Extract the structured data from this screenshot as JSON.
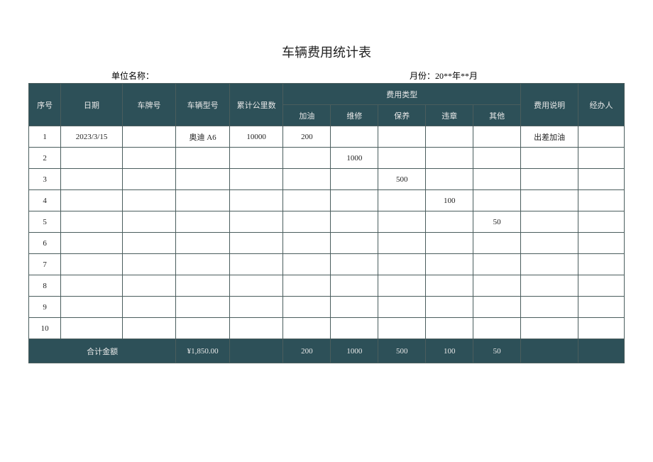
{
  "title": "车辆费用统计表",
  "meta": {
    "unit_label": "单位名称：",
    "month_label": "月份：20**年**月"
  },
  "headers": {
    "seq": "序号",
    "date": "日期",
    "plate": "车牌号",
    "model": "车辆型号",
    "km": "累计公里数",
    "fee_type": "费用类型",
    "fuel": "加油",
    "repair": "维修",
    "maint": "保养",
    "violation": "违章",
    "other": "其他",
    "desc": "费用说明",
    "agent": "经办人"
  },
  "rows": [
    {
      "seq": "1",
      "date": "2023/3/15",
      "plate": "",
      "model": "奥迪 A6",
      "km": "10000",
      "fuel": "200",
      "repair": "",
      "maint": "",
      "violation": "",
      "other": "",
      "desc": "出差加油",
      "agent": ""
    },
    {
      "seq": "2",
      "date": "",
      "plate": "",
      "model": "",
      "km": "",
      "fuel": "",
      "repair": "1000",
      "maint": "",
      "violation": "",
      "other": "",
      "desc": "",
      "agent": ""
    },
    {
      "seq": "3",
      "date": "",
      "plate": "",
      "model": "",
      "km": "",
      "fuel": "",
      "repair": "",
      "maint": "500",
      "violation": "",
      "other": "",
      "desc": "",
      "agent": ""
    },
    {
      "seq": "4",
      "date": "",
      "plate": "",
      "model": "",
      "km": "",
      "fuel": "",
      "repair": "",
      "maint": "",
      "violation": "100",
      "other": "",
      "desc": "",
      "agent": ""
    },
    {
      "seq": "5",
      "date": "",
      "plate": "",
      "model": "",
      "km": "",
      "fuel": "",
      "repair": "",
      "maint": "",
      "violation": "",
      "other": "50",
      "desc": "",
      "agent": ""
    },
    {
      "seq": "6",
      "date": "",
      "plate": "",
      "model": "",
      "km": "",
      "fuel": "",
      "repair": "",
      "maint": "",
      "violation": "",
      "other": "",
      "desc": "",
      "agent": ""
    },
    {
      "seq": "7",
      "date": "",
      "plate": "",
      "model": "",
      "km": "",
      "fuel": "",
      "repair": "",
      "maint": "",
      "violation": "",
      "other": "",
      "desc": "",
      "agent": ""
    },
    {
      "seq": "8",
      "date": "",
      "plate": "",
      "model": "",
      "km": "",
      "fuel": "",
      "repair": "",
      "maint": "",
      "violation": "",
      "other": "",
      "desc": "",
      "agent": ""
    },
    {
      "seq": "9",
      "date": "",
      "plate": "",
      "model": "",
      "km": "",
      "fuel": "",
      "repair": "",
      "maint": "",
      "violation": "",
      "other": "",
      "desc": "",
      "agent": ""
    },
    {
      "seq": "10",
      "date": "",
      "plate": "",
      "model": "",
      "km": "",
      "fuel": "",
      "repair": "",
      "maint": "",
      "violation": "",
      "other": "",
      "desc": "",
      "agent": ""
    }
  ],
  "totals": {
    "label": "合计金额",
    "amount": "¥1,850.00",
    "fuel": "200",
    "repair": "1000",
    "maint": "500",
    "violation": "100",
    "other": "50"
  },
  "chart_data": {
    "type": "table",
    "title": "车辆费用统计表",
    "columns": [
      "序号",
      "日期",
      "车牌号",
      "车辆型号",
      "累计公里数",
      "加油",
      "维修",
      "保养",
      "违章",
      "其他",
      "费用说明",
      "经办人"
    ],
    "rows": [
      [
        "1",
        "2023/3/15",
        "",
        "奥迪 A6",
        "10000",
        "200",
        "",
        "",
        "",
        "",
        "出差加油",
        ""
      ],
      [
        "2",
        "",
        "",
        "",
        "",
        "",
        "1000",
        "",
        "",
        "",
        "",
        ""
      ],
      [
        "3",
        "",
        "",
        "",
        "",
        "",
        "",
        "500",
        "",
        "",
        "",
        ""
      ],
      [
        "4",
        "",
        "",
        "",
        "",
        "",
        "",
        "",
        "100",
        "",
        "",
        ""
      ],
      [
        "5",
        "",
        "",
        "",
        "",
        "",
        "",
        "",
        "",
        "50",
        "",
        ""
      ],
      [
        "6",
        "",
        "",
        "",
        "",
        "",
        "",
        "",
        "",
        "",
        "",
        ""
      ],
      [
        "7",
        "",
        "",
        "",
        "",
        "",
        "",
        "",
        "",
        "",
        "",
        ""
      ],
      [
        "8",
        "",
        "",
        "",
        "",
        "",
        "",
        "",
        "",
        "",
        "",
        ""
      ],
      [
        "9",
        "",
        "",
        "",
        "",
        "",
        "",
        "",
        "",
        "",
        "",
        ""
      ],
      [
        "10",
        "",
        "",
        "",
        "",
        "",
        "",
        "",
        "",
        "",
        "",
        ""
      ]
    ],
    "totals_row": [
      "合计金额",
      "",
      "",
      "¥1,850.00",
      "",
      "200",
      "1000",
      "500",
      "100",
      "50",
      "",
      ""
    ]
  }
}
